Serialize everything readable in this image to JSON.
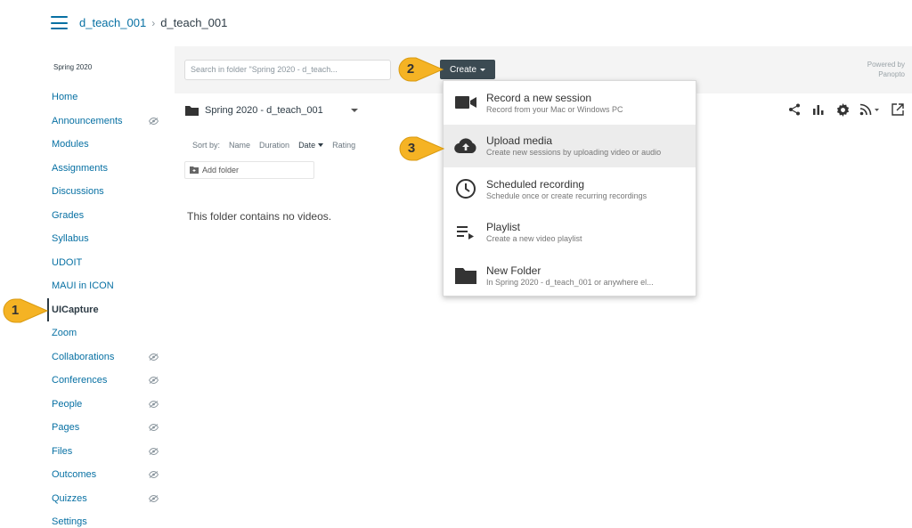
{
  "breadcrumb": {
    "course": "d_teach_001",
    "current": "d_teach_001"
  },
  "sidebar": {
    "term": "Spring 2020",
    "items": [
      {
        "label": "Home",
        "hidden": false
      },
      {
        "label": "Announcements",
        "hidden": true
      },
      {
        "label": "Modules",
        "hidden": false
      },
      {
        "label": "Assignments",
        "hidden": false
      },
      {
        "label": "Discussions",
        "hidden": false
      },
      {
        "label": "Grades",
        "hidden": false
      },
      {
        "label": "Syllabus",
        "hidden": false
      },
      {
        "label": "UDOIT",
        "hidden": false
      },
      {
        "label": "MAUI in ICON",
        "hidden": false
      },
      {
        "label": "UICapture",
        "hidden": false,
        "active": true
      },
      {
        "label": "Zoom",
        "hidden": false
      },
      {
        "label": "Collaborations",
        "hidden": true
      },
      {
        "label": "Conferences",
        "hidden": true
      },
      {
        "label": "People",
        "hidden": true
      },
      {
        "label": "Pages",
        "hidden": true
      },
      {
        "label": "Files",
        "hidden": true
      },
      {
        "label": "Outcomes",
        "hidden": true
      },
      {
        "label": "Quizzes",
        "hidden": true
      },
      {
        "label": "Settings",
        "hidden": false
      }
    ]
  },
  "toolbar": {
    "search_placeholder": "Search in folder \"Spring 2020 - d_teach...",
    "create_label": "Create",
    "powered_line1": "Powered by",
    "powered_line2": "Panopto"
  },
  "folder": {
    "name": "Spring 2020 - d_teach_001",
    "sort_label": "Sort by:",
    "sort_options": [
      "Name",
      "Duration",
      "Date",
      "Rating"
    ],
    "sort_active": "Date",
    "add_folder": "Add folder",
    "empty_message": "This folder contains no videos."
  },
  "create_menu": [
    {
      "icon": "video-camera-icon",
      "title": "Record a new session",
      "desc": "Record from your Mac or Windows PC"
    },
    {
      "icon": "cloud-upload-icon",
      "title": "Upload media",
      "desc": "Create new sessions by uploading video or audio",
      "highlighted": true
    },
    {
      "icon": "clock-icon",
      "title": "Scheduled recording",
      "desc": "Schedule once or create recurring recordings"
    },
    {
      "icon": "playlist-icon",
      "title": "Playlist",
      "desc": "Create a new video playlist"
    },
    {
      "icon": "folder-icon",
      "title": "New Folder",
      "desc": "In Spring 2020 - d_teach_001 or anywhere el..."
    }
  ],
  "callouts": [
    "1",
    "2",
    "3"
  ],
  "colors": {
    "link": "#0770a3",
    "callout": "#f5b324",
    "create_button": "#3b4a52"
  }
}
